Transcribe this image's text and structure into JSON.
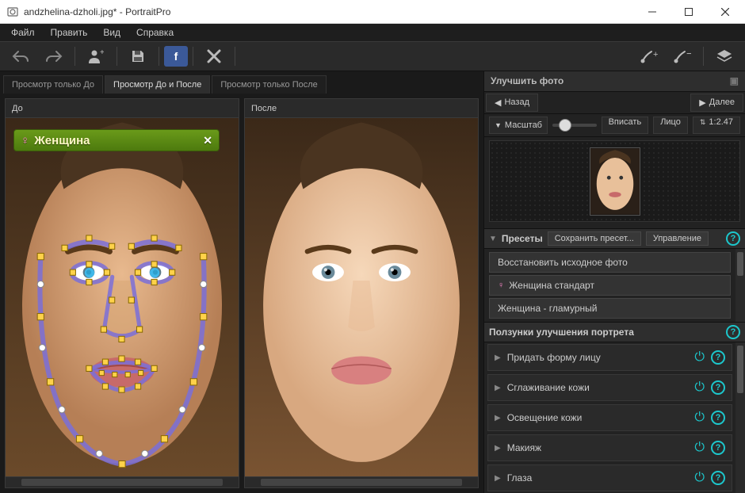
{
  "window": {
    "title": "andzhelina-dzholi.jpg* - PortraitPro"
  },
  "menubar": {
    "file": "Файл",
    "edit": "Править",
    "view": "Вид",
    "help": "Справка"
  },
  "tabs": {
    "before_only": "Просмотр только До",
    "before_after": "Просмотр До и После",
    "after_only": "Просмотр только После"
  },
  "panes": {
    "before": "До",
    "after": "После"
  },
  "gender_tag": {
    "label": "Женщина"
  },
  "right_panel": {
    "title": "Улучшить фото",
    "back": "Назад",
    "next": "Далее",
    "zoom_label": "Масштаб",
    "fit": "Вписать",
    "face": "Лицо",
    "ratio": "1:2.47",
    "presets": {
      "title": "Пресеты",
      "save": "Сохранить пресет...",
      "manage": "Управление",
      "items": [
        {
          "label": "Восстановить исходное фото",
          "female": false
        },
        {
          "label": "Женщина стандарт",
          "female": true
        },
        {
          "label": "Женщина - гламурный",
          "female": false
        }
      ]
    },
    "sliders_title": "Ползунки улучшения портрета",
    "sliders": [
      {
        "label": "Придать форму лицу"
      },
      {
        "label": "Сглаживание кожи"
      },
      {
        "label": "Освещение кожи"
      },
      {
        "label": "Макияж"
      },
      {
        "label": "Глаза"
      }
    ]
  }
}
